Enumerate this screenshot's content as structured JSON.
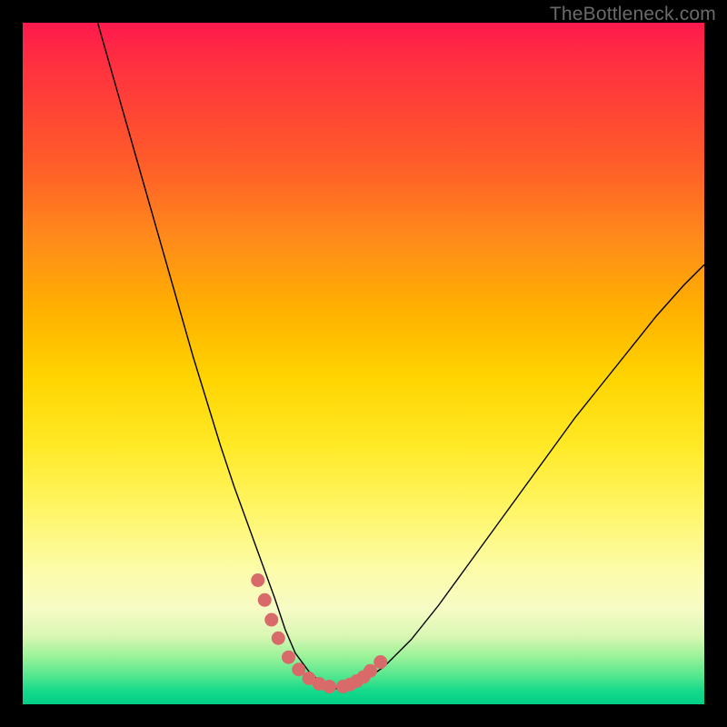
{
  "watermark": "TheBottleneck.com",
  "colors": {
    "background_border": "#000000",
    "curve_stroke": "#000000",
    "marker_fill": "#d86a6a",
    "gradient_top": "#ff1a4d",
    "gradient_bottom": "#00cf88"
  },
  "chart_data": {
    "type": "line",
    "title": "",
    "xlabel": "",
    "ylabel": "",
    "xlim": [
      0,
      100
    ],
    "ylim": [
      0,
      100
    ],
    "note": "Axes are unlabeled in the source image. x is normalized horizontal position 0–100 left→right; y is normalized value 0–100 where 100 = top of gradient area and 0 = bottom (green).",
    "series": [
      {
        "name": "bottleneck-curve",
        "x": [
          11,
          13,
          15,
          17,
          19,
          21,
          23,
          25,
          27,
          29,
          31,
          33,
          35,
          37,
          38.5,
          40,
          42,
          44,
          46,
          48,
          50,
          53,
          57,
          61,
          65,
          69,
          73,
          77,
          81,
          85,
          89,
          93,
          97,
          100
        ],
        "values": [
          100,
          93,
          86,
          79,
          72,
          65,
          58,
          51,
          44.5,
          38,
          32,
          26.5,
          21,
          15.5,
          11,
          7.5,
          4.8,
          3.0,
          2.3,
          2.5,
          3.4,
          5.5,
          9.5,
          14.5,
          20,
          25.5,
          31,
          36.5,
          42,
          47,
          52,
          57,
          61.5,
          64.5
        ]
      }
    ],
    "markers": {
      "name": "highlight-dots",
      "x": [
        34.5,
        35.5,
        36.5,
        37.5,
        39.0,
        40.5,
        42.0,
        43.5,
        45.0,
        47.0,
        48.0,
        49.0,
        50.0,
        51.0,
        52.5
      ],
      "values": [
        18.2,
        15.3,
        12.4,
        9.7,
        6.9,
        5.1,
        3.8,
        3.0,
        2.6,
        2.6,
        2.9,
        3.4,
        4.0,
        4.9,
        6.2
      ],
      "radius_px": 7.5
    }
  }
}
